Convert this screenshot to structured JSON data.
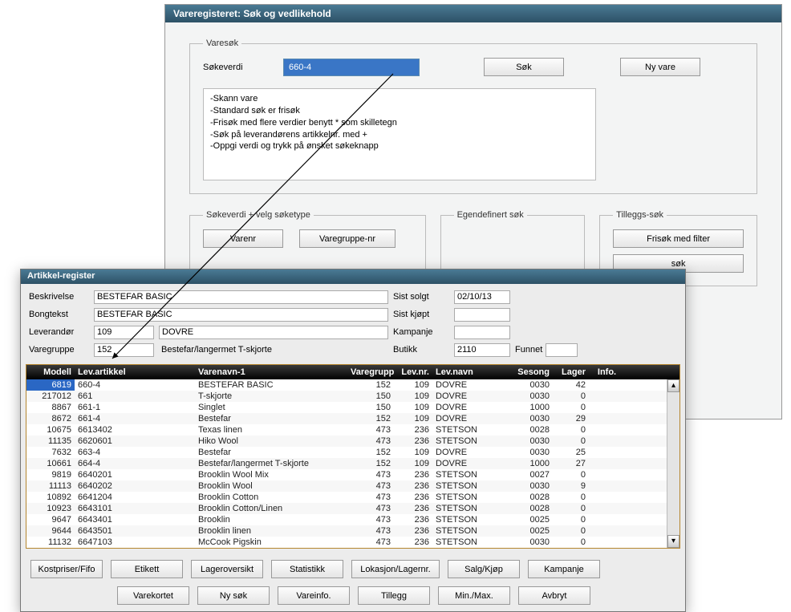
{
  "main": {
    "title": "Vareregisteret: Søk og vedlikehold",
    "search": {
      "fieldset_label": "Varesøk",
      "label": "Søkeverdi",
      "value": "660-4",
      "sok_btn": "Søk",
      "nyvare_btn": "Ny vare",
      "help_l1": "-Skann vare",
      "help_l2": "-Standard søk er frisøk",
      "help_l3": "-Frisøk med flere verdier benytt * som skilletegn",
      "help_l4": "-Søk på leverandørens artikkelnr. med +",
      "help_l5": "-Oppgi verdi og trykk på ønsket søkeknapp"
    },
    "soketype": {
      "legend": "Søkeverdi + velg søketype",
      "b1": "Varenr",
      "b2": "Varegruppe-nr"
    },
    "egendef": {
      "legend": "Egendefinert søk"
    },
    "tillegg": {
      "legend": "Tilleggs-søk",
      "b1": "Frisøk med filter",
      "b2": "søk"
    }
  },
  "reg": {
    "title": "Artikkel-register",
    "labels": {
      "beskrivelse": "Beskrivelse",
      "bongtekst": "Bongtekst",
      "leverandor": "Leverandør",
      "varegruppe": "Varegruppe",
      "sist_solgt": "Sist solgt",
      "sist_kjopt": "Sist kjøpt",
      "kampanje": "Kampanje",
      "butikk": "Butikk",
      "funnet": "Funnet"
    },
    "vals": {
      "beskrivelse": "BESTEFAR BASIC",
      "bongtekst": "BESTEFAR BASIC",
      "lev_nr": "109",
      "lev_navn": "DOVRE",
      "vg_nr": "152",
      "vg_navn": "Bestefar/langermet T-skjorte",
      "sist_solgt": "02/10/13",
      "sist_kjopt": "",
      "kampanje": "",
      "butikk": "2110",
      "funnet": ""
    },
    "cols": {
      "modell": "Modell",
      "art": "Lev.artikkel",
      "navn": "Varenavn-1",
      "vg": "Varegruppe",
      "levnr": "Lev.nr.",
      "levnavn": "Lev.navn",
      "ses": "Sesong",
      "lag": "Lager",
      "info": "Info."
    },
    "rows": [
      {
        "modell": "6819",
        "art": "660-4",
        "navn": "BESTEFAR BASIC",
        "vg": "152",
        "levnr": "109",
        "levnavn": "DOVRE",
        "ses": "0030",
        "lag": "42",
        "info": ""
      },
      {
        "modell": "217012",
        "art": "661",
        "navn": "T-skjorte",
        "vg": "150",
        "levnr": "109",
        "levnavn": "DOVRE",
        "ses": "0030",
        "lag": "0",
        "info": ""
      },
      {
        "modell": "8867",
        "art": "661-1",
        "navn": "Singlet",
        "vg": "150",
        "levnr": "109",
        "levnavn": "DOVRE",
        "ses": "1000",
        "lag": "0",
        "info": ""
      },
      {
        "modell": "8672",
        "art": "661-4",
        "navn": "Bestefar",
        "vg": "152",
        "levnr": "109",
        "levnavn": "DOVRE",
        "ses": "0030",
        "lag": "29",
        "info": ""
      },
      {
        "modell": "10675",
        "art": "6613402",
        "navn": "Texas linen",
        "vg": "473",
        "levnr": "236",
        "levnavn": "STETSON",
        "ses": "0028",
        "lag": "0",
        "info": ""
      },
      {
        "modell": "11135",
        "art": "6620601",
        "navn": "Hiko Wool",
        "vg": "473",
        "levnr": "236",
        "levnavn": "STETSON",
        "ses": "0030",
        "lag": "0",
        "info": ""
      },
      {
        "modell": "7632",
        "art": "663-4",
        "navn": "Bestefar",
        "vg": "152",
        "levnr": "109",
        "levnavn": "DOVRE",
        "ses": "0030",
        "lag": "25",
        "info": ""
      },
      {
        "modell": "10661",
        "art": "664-4",
        "navn": "Bestefar/langermet T-skjorte",
        "vg": "152",
        "levnr": "109",
        "levnavn": "DOVRE",
        "ses": "1000",
        "lag": "27",
        "info": ""
      },
      {
        "modell": "9819",
        "art": "6640201",
        "navn": "Brooklin Wool Mix",
        "vg": "473",
        "levnr": "236",
        "levnavn": "STETSON",
        "ses": "0027",
        "lag": "0",
        "info": ""
      },
      {
        "modell": "11113",
        "art": "6640202",
        "navn": "Brooklin Wool",
        "vg": "473",
        "levnr": "236",
        "levnavn": "STETSON",
        "ses": "0030",
        "lag": "9",
        "info": ""
      },
      {
        "modell": "10892",
        "art": "6641204",
        "navn": "Brooklin Cotton",
        "vg": "473",
        "levnr": "236",
        "levnavn": "STETSON",
        "ses": "0028",
        "lag": "0",
        "info": ""
      },
      {
        "modell": "10923",
        "art": "6643101",
        "navn": "Brooklin Cotton/Linen",
        "vg": "473",
        "levnr": "236",
        "levnavn": "STETSON",
        "ses": "0028",
        "lag": "0",
        "info": ""
      },
      {
        "modell": "9647",
        "art": "6643401",
        "navn": "Brooklin",
        "vg": "473",
        "levnr": "236",
        "levnavn": "STETSON",
        "ses": "0025",
        "lag": "0",
        "info": ""
      },
      {
        "modell": "9644",
        "art": "6643501",
        "navn": "Brooklin linen",
        "vg": "473",
        "levnr": "236",
        "levnavn": "STETSON",
        "ses": "0025",
        "lag": "0",
        "info": ""
      },
      {
        "modell": "11132",
        "art": "6647103",
        "navn": "McCook Pigskin",
        "vg": "473",
        "levnr": "236",
        "levnavn": "STETSON",
        "ses": "0030",
        "lag": "0",
        "info": ""
      }
    ],
    "btns1": {
      "b1": "Kostpriser/Fifo",
      "b2": "Etikett",
      "b3": "Lageroversikt",
      "b4": "Statistikk",
      "b5": "Lokasjon/Lagernr.",
      "b6": "Salg/Kjøp",
      "b7": "Kampanje"
    },
    "btns2": {
      "b1": "Varekortet",
      "b2": "Ny søk",
      "b3": "Vareinfo.",
      "b4": "Tillegg",
      "b5": "Min./Max.",
      "b6": "Avbryt"
    }
  }
}
